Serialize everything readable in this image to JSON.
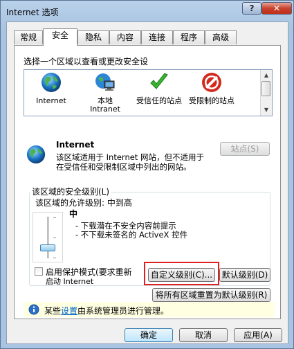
{
  "window": {
    "title": "Internet 选项",
    "help_label": "?",
    "close_label": "✕"
  },
  "tabs": [
    {
      "label": "常规",
      "active": false
    },
    {
      "label": "安全",
      "active": true
    },
    {
      "label": "隐私",
      "active": false
    },
    {
      "label": "内容",
      "active": false
    },
    {
      "label": "连接",
      "active": false
    },
    {
      "label": "程序",
      "active": false
    },
    {
      "label": "高级",
      "active": false
    }
  ],
  "security": {
    "zone_prompt": "选择一个区域以查看或更改安全设",
    "zones": [
      {
        "label": "Internet",
        "icon": "globe-icon",
        "selected": true
      },
      {
        "label": "本地\nIntranet",
        "icon": "local-intranet-icon",
        "selected": false
      },
      {
        "label": "受信任的站点",
        "icon": "checkmark-icon",
        "selected": false
      },
      {
        "label": "受限制的站点",
        "icon": "restricted-icon",
        "selected": false
      }
    ],
    "zone_name": "Internet",
    "zone_desc_line1": "该区域适用于 Internet 网站，但不适用于",
    "zone_desc_line2": "在受信任和受限制区域中列出的网站。",
    "sites_button": "站点(S)",
    "level_group_title": "该区域的安全级别(L)",
    "allowed_levels": "该区域的允许级别: 中到高",
    "level_name": "中",
    "level_bullets": [
      "- 下载潜在不安全内容前提示",
      "- 不下载未签名的 ActiveX 控件"
    ],
    "slider_level_fraction": 0.2,
    "protected_mode_line1": "启用保护模式(要求重新",
    "protected_mode_line2": "启动 Internet",
    "protected_mode_checked": false,
    "custom_level_button": "自定义级别(C)...",
    "default_level_button": "默认级别(D)",
    "reset_all_button": "将所有区域重置为默认级别(R)",
    "info_prefix": "某些",
    "info_link": "设置",
    "info_suffix": "由系统管理员进行管理。"
  },
  "footer": {
    "ok": "确定",
    "cancel": "取消",
    "apply": "应用(A)"
  },
  "colors": {
    "highlight_box": "#e02020",
    "info_background": "#ffffe1",
    "link": "#0066cc"
  }
}
